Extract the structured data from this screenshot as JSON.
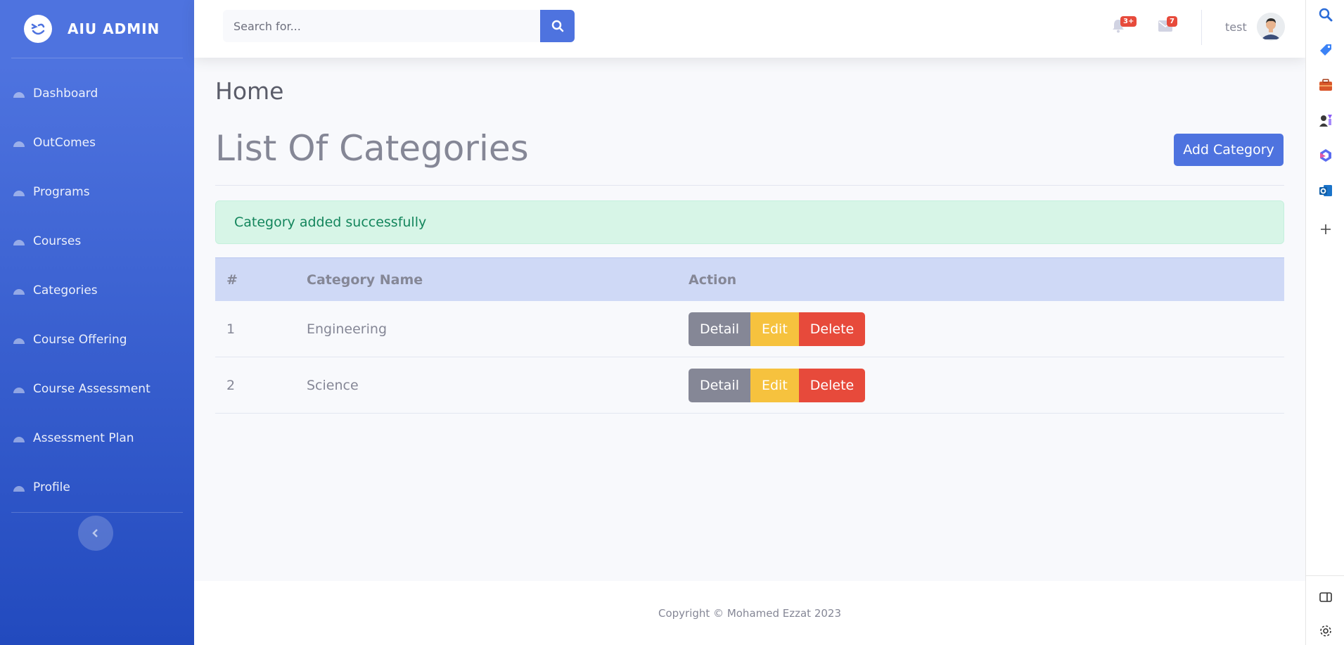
{
  "brand": {
    "name": "AIU ADMIN"
  },
  "sidebar": {
    "items": [
      {
        "label": "Dashboard"
      },
      {
        "label": "OutComes"
      },
      {
        "label": "Programs"
      },
      {
        "label": "Courses"
      },
      {
        "label": "Categories"
      },
      {
        "label": "Course Offering"
      },
      {
        "label": "Course Assessment"
      },
      {
        "label": "Assessment Plan"
      },
      {
        "label": "Profile"
      }
    ]
  },
  "topbar": {
    "search_placeholder": "Search for...",
    "alerts_badge": "3+",
    "messages_badge": "7",
    "username": "test"
  },
  "main": {
    "breadcrumb": "Home",
    "title": "List Of Categories",
    "add_button": "Add Category",
    "alert_message": "Category added successfully",
    "table": {
      "headers": [
        "#",
        "Category Name",
        "Action"
      ],
      "rows": [
        {
          "num": "1",
          "name": "Engineering"
        },
        {
          "num": "2",
          "name": "Science"
        }
      ],
      "actions": {
        "detail": "Detail",
        "edit": "Edit",
        "delete": "Delete"
      }
    }
  },
  "footer": {
    "text": "Copyright © Mohamed Ezzat 2023"
  },
  "colors": {
    "primary": "#4e73df",
    "success_bg": "#d7f5e7",
    "warning": "#f6c23e",
    "danger": "#e74a3b",
    "secondary": "#858796"
  }
}
